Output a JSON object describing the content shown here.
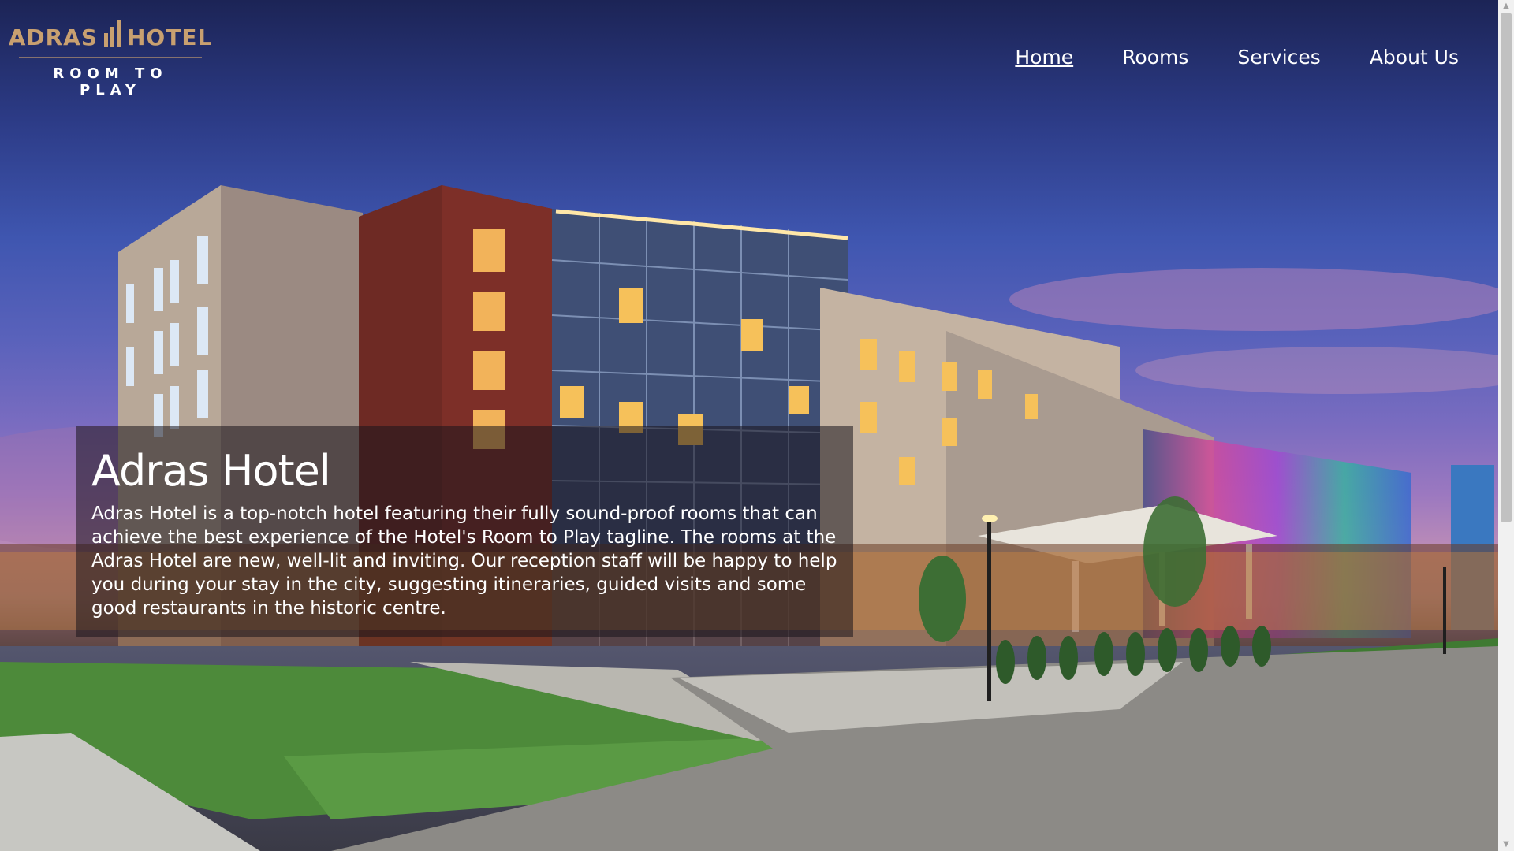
{
  "logo": {
    "left_text": "ADRAS",
    "right_text": "HOTEL",
    "tagline": "ROOM TO PLAY",
    "color": "#c8a070"
  },
  "nav": {
    "items": [
      {
        "label": "Home",
        "active": true
      },
      {
        "label": "Rooms",
        "active": false
      },
      {
        "label": "Services",
        "active": false
      },
      {
        "label": "About Us",
        "active": false
      }
    ]
  },
  "hero": {
    "image": "hotel-exterior-at-dusk",
    "title": "Adras Hotel",
    "description": "Adras Hotel is a top-notch hotel featuring their fully sound-proof rooms that can achieve the best experience of the Hotel's Room to Play tagline. The rooms at the Adras Hotel are new, well-lit and inviting. Our reception staff will be happy to help you during your stay in the city, suggesting itineraries, guided visits and some good restaurants in the historic centre."
  }
}
